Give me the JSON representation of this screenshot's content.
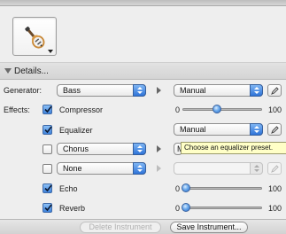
{
  "instrument": {
    "icon": "electric-guitar-icon"
  },
  "details": {
    "label": "Details..."
  },
  "generator": {
    "label": "Generator:",
    "selected": "Bass",
    "preset": "Manual"
  },
  "effects": {
    "label": "Effects:",
    "compressor": {
      "name": "Compressor",
      "checked": true,
      "min": "0",
      "max": "100",
      "value": 40
    },
    "equalizer": {
      "name": "Equalizer",
      "checked": true,
      "preset": "Manual"
    },
    "slot1": {
      "selected": "Chorus",
      "checked": false,
      "preset": "M"
    },
    "slot2": {
      "selected": "None",
      "checked": false
    },
    "echo": {
      "name": "Echo",
      "checked": true,
      "min": "0",
      "max": "100",
      "value": 0
    },
    "reverb": {
      "name": "Reverb",
      "checked": true,
      "min": "0",
      "max": "100",
      "value": 0
    }
  },
  "tooltip": {
    "text": "Choose an equalizer preset."
  },
  "buttons": {
    "delete_instrument": "Delete Instrument",
    "save_instrument": "Save Instrument..."
  },
  "colors": {
    "accent": "#3e82dc",
    "tooltip_bg": "#ffffc7"
  }
}
